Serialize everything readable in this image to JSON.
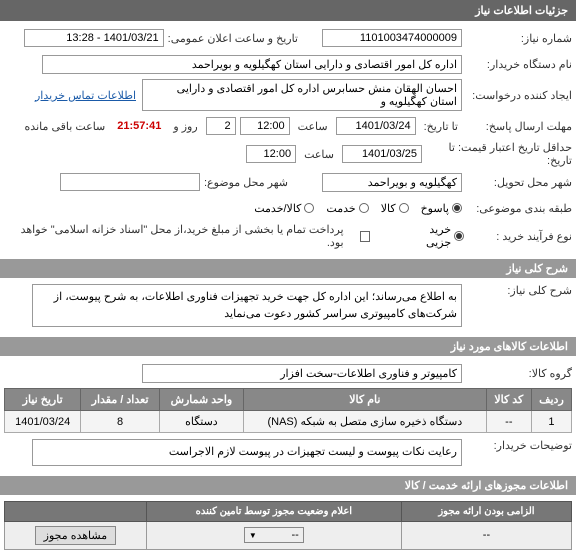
{
  "sections": {
    "need_info": "جزئیات اطلاعات نیاز",
    "need_summary": "شرح کلی نیاز",
    "goods_info": "اطلاعات کالاهای مورد نیاز",
    "service_auth": "اطلاعات مجوزهای ارائه خدمت / کالا"
  },
  "labels": {
    "need_no": "شماره نیاز:",
    "announce_date": "تاریخ و ساعت اعلان عمومی:",
    "buyer_org": "نام دستگاه خریدار:",
    "requester": "ایجاد کننده درخواست:",
    "contact_link": "اطلاعات تماس خریدار",
    "reply_deadline": "مهلت ارسال پاسخ:",
    "to_date": "تا تاریخ:",
    "sa3at": "ساعت",
    "rooz_va": "روز و",
    "remain_suffix": "ساعت باقی مانده",
    "min_validity": "حداقل تاریخ اعتبار قیمت: تا تاریخ:",
    "delivery_city": "شهر محل تحویل:",
    "subject_city": "شهر محل موضوع:",
    "classification": "طبقه بندی موضوعی:",
    "pasokh": "پاسوخ",
    "kala": "کالا",
    "khedmat": "خدمت",
    "kala_khedmat": "کالا/خدمت",
    "purchase_type": "نوع فرآیند خرید :",
    "kharid_jozi": "خرید جزیی",
    "payment_note": "پرداخت تمام یا بخشی از مبلغ خرید،از محل \"اسناد خزانه اسلامی\" خواهد بود.",
    "need_desc": "شرح کلی نیاز:",
    "goods_group": "گروه کالا:",
    "buyer_notes": "توضیحات خریدار:"
  },
  "values": {
    "need_no": "1101003474000009",
    "announce_date": "1401/03/21 - 13:28",
    "buyer_org": "اداره کل امور اقتصادی و دارایی استان کهگیلویه و بویراحمد",
    "requester": "احسان الهقان منش حسابرس اداره کل امور اقتصادی و دارایی استان کهگیلویه و",
    "reply_date": "1401/03/24",
    "reply_time": "12:00",
    "days_left": "2",
    "time_left": "21:57:41",
    "validity_date": "1401/03/25",
    "validity_time": "12:00",
    "delivery_city": "کهگیلویه و بویراحمد",
    "need_desc": "به اطلاع می‌رساند؛ این اداره کل جهت خرید تجهیزات فناوری اطلاعات، به شرح پیوست، از شرکت‌های کامپیوتری سراسر کشور دعوت می‌نماید",
    "goods_group": "کامپیوتر و فناوری اطلاعات-سخت افزار",
    "buyer_notes": "رعایت نکات پیوست و لیست تجهیزات در پیوست لازم الاجراست"
  },
  "goods_table": {
    "headers": [
      "ردیف",
      "کد کالا",
      "نام کالا",
      "واحد شمارش",
      "تعداد / مقدار",
      "تاریخ نیاز"
    ],
    "rows": [
      {
        "idx": "1",
        "code": "--",
        "name": "دستگاه ذخیره سازی متصل به شبکه (NAS)",
        "unit": "دستگاه",
        "qty": "8",
        "date": "1401/03/24"
      }
    ]
  },
  "auth_table": {
    "headers": [
      "الزامی بودن ارائه مجوز",
      "اعلام وضعیت مجوز توسط تامین کننده",
      ""
    ],
    "row": {
      "c1": "--",
      "c2_sel": "--",
      "btn": "مشاهده مجوز"
    }
  }
}
